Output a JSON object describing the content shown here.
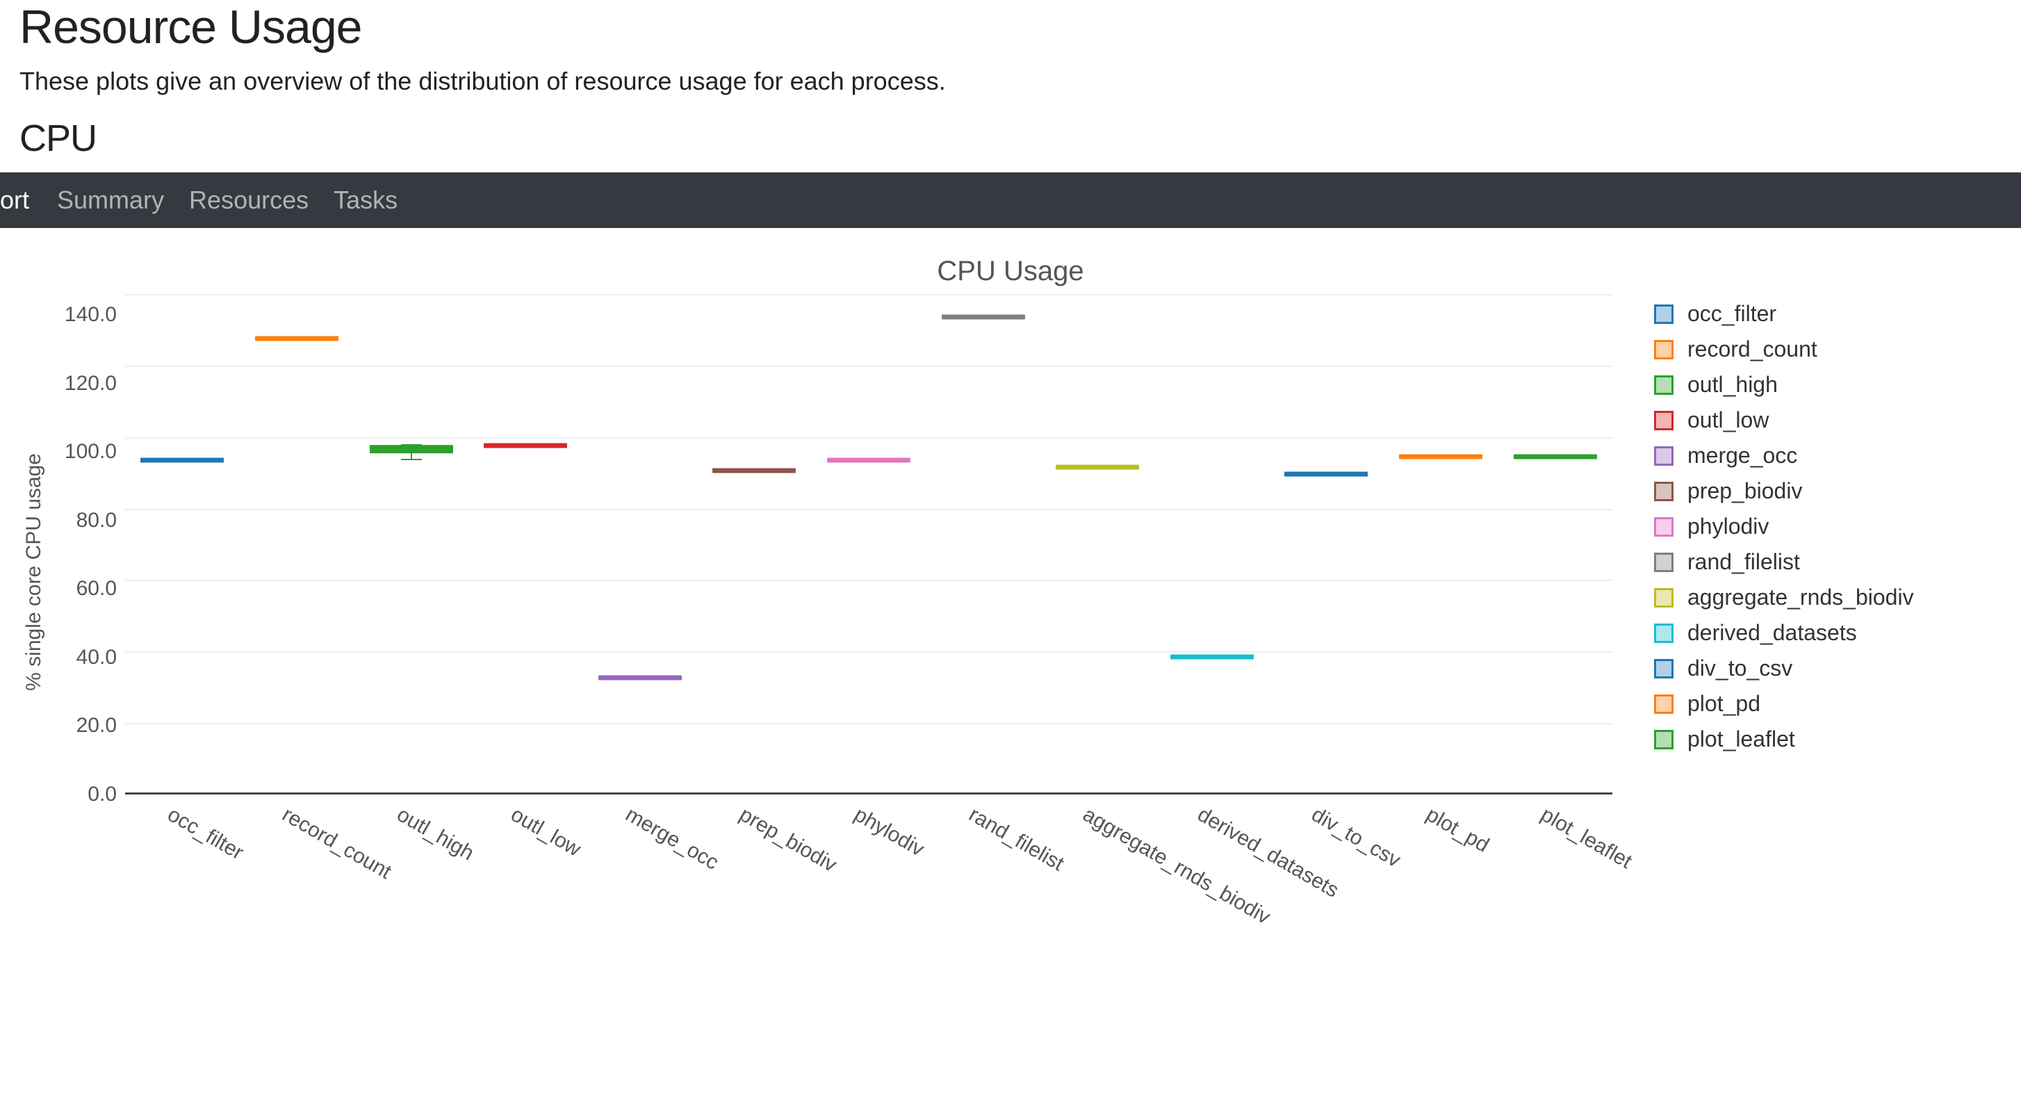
{
  "header": {
    "title": "Resource Usage",
    "subtitle": "These plots give an overview of the distribution of resource usage for each process.",
    "section": "CPU"
  },
  "navbar": {
    "brand_fragment": "ort",
    "items": [
      "Summary",
      "Resources",
      "Tasks"
    ]
  },
  "chart_data": {
    "type": "box",
    "title": "CPU Usage",
    "ylabel": "% single core CPU usage",
    "xlabel": "",
    "ylim": [
      0.0,
      140.0
    ],
    "yticks": [
      0.0,
      20.0,
      40.0,
      60.0,
      80.0,
      100.0,
      120.0,
      140.0
    ],
    "categories": [
      "occ_filter",
      "record_count",
      "outl_high",
      "outl_low",
      "merge_occ",
      "prep_biodiv",
      "phylodiv",
      "rand_filelist",
      "aggregate_rnds_biodiv",
      "derived_datasets",
      "div_to_csv",
      "plot_pd",
      "plot_leaflet"
    ],
    "series": [
      {
        "name": "occ_filter",
        "median": 93,
        "low": 93,
        "high": 93,
        "color": "#1f77b4"
      },
      {
        "name": "record_count",
        "median": 127,
        "low": 127,
        "high": 127,
        "color": "#ff7f0e"
      },
      {
        "name": "outl_high",
        "median": 96,
        "low": 94,
        "high": 98,
        "color": "#2ca02c"
      },
      {
        "name": "outl_low",
        "median": 97,
        "low": 97,
        "high": 97,
        "color": "#d62728"
      },
      {
        "name": "merge_occ",
        "median": 32,
        "low": 32,
        "high": 32,
        "color": "#9467bd"
      },
      {
        "name": "prep_biodiv",
        "median": 90,
        "low": 90,
        "high": 90,
        "color": "#8c564b"
      },
      {
        "name": "phylodiv",
        "median": 93,
        "low": 93,
        "high": 93,
        "color": "#e377c2"
      },
      {
        "name": "rand_filelist",
        "median": 133,
        "low": 133,
        "high": 133,
        "color": "#7f7f7f"
      },
      {
        "name": "aggregate_rnds_biodiv",
        "median": 91,
        "low": 91,
        "high": 91,
        "color": "#bcbd22"
      },
      {
        "name": "derived_datasets",
        "median": 38,
        "low": 38,
        "high": 38,
        "color": "#17becf"
      },
      {
        "name": "div_to_csv",
        "median": 89,
        "low": 89,
        "high": 89,
        "color": "#1f77b4"
      },
      {
        "name": "plot_pd",
        "median": 94,
        "low": 94,
        "high": 94,
        "color": "#ff7f0e"
      },
      {
        "name": "plot_leaflet",
        "median": 94,
        "low": 94,
        "high": 94,
        "color": "#2ca02c"
      }
    ],
    "legend": [
      {
        "name": "occ_filter",
        "color": "#1f77b4"
      },
      {
        "name": "record_count",
        "color": "#ff7f0e"
      },
      {
        "name": "outl_high",
        "color": "#2ca02c"
      },
      {
        "name": "outl_low",
        "color": "#d62728"
      },
      {
        "name": "merge_occ",
        "color": "#9467bd"
      },
      {
        "name": "prep_biodiv",
        "color": "#8c564b"
      },
      {
        "name": "phylodiv",
        "color": "#e377c2"
      },
      {
        "name": "rand_filelist",
        "color": "#7f7f7f"
      },
      {
        "name": "aggregate_rnds_biodiv",
        "color": "#bcbd22"
      },
      {
        "name": "derived_datasets",
        "color": "#17becf"
      },
      {
        "name": "div_to_csv",
        "color": "#1f77b4"
      },
      {
        "name": "plot_pd",
        "color": "#ff7f0e"
      },
      {
        "name": "plot_leaflet",
        "color": "#2ca02c"
      }
    ]
  }
}
